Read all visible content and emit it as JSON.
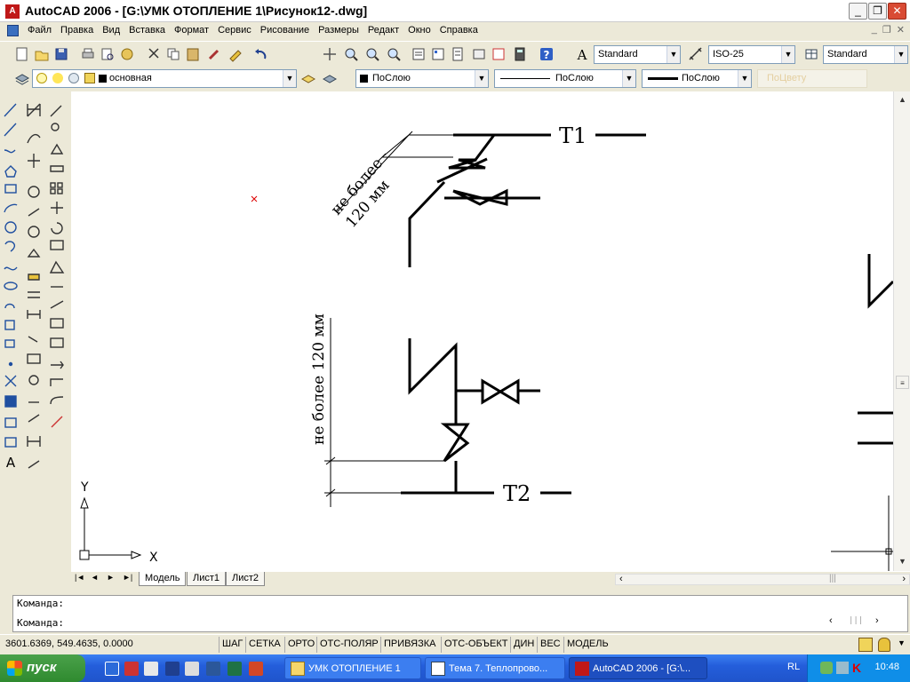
{
  "window": {
    "title": "AutoCAD 2006 - [G:\\УМК ОТОПЛЕНИЕ 1\\Рисунок12-.dwg]",
    "app_icon": "A",
    "minimize": "_",
    "maximize": "❐",
    "close": "✕"
  },
  "menu": {
    "items": [
      "Файл",
      "Правка",
      "Вид",
      "Вставка",
      "Формат",
      "Сервис",
      "Рисование",
      "Размеры",
      "Редакт",
      "Окно",
      "Справка"
    ],
    "mdi": [
      "_",
      "❐",
      "✕"
    ]
  },
  "toolbar": {
    "text_style": "Standard",
    "dim_style": "ISO-25",
    "table_style": "Standard",
    "layer": "основная",
    "color": "ПоСлою",
    "linetype": "ПоСлою",
    "lineweight": "ПоСлою",
    "plotstyle": "ПоЦвету"
  },
  "drawing": {
    "t1_label": "Т1",
    "t2_label": "Т2",
    "dim_text_top_line1": "не более",
    "dim_text_top_line2": "120 мм",
    "dim_text_bottom": "не более 120 мм",
    "ucs_x": "X",
    "ucs_y": "Y"
  },
  "tabs": {
    "items": [
      "Модель",
      "Лист1",
      "Лист2"
    ],
    "active": "Модель",
    "nav": [
      "|◄",
      "◄",
      "►",
      "►|"
    ]
  },
  "command": {
    "line1": "Команда:",
    "line2": "Команда:"
  },
  "status": {
    "coords": "3601.6369, 549.4635, 0.0000",
    "buttons": [
      "ШАГ",
      "СЕТКА",
      "ОРТО",
      "ОТС-ПОЛЯР",
      "ПРИВЯЗКА",
      "ОТС-ОБЪЕКТ",
      "ДИН",
      "ВЕС",
      "МОДЕЛЬ"
    ]
  },
  "taskbar": {
    "start": "пуск",
    "tasks": [
      {
        "label": "УМК ОТОПЛЕНИЕ 1",
        "active": false
      },
      {
        "label": "Тема 7. Теплопрово...",
        "active": false
      },
      {
        "label": "AutoCAD 2006 - [G:\\...",
        "active": true
      }
    ],
    "lang": "RL",
    "clock": "10:48"
  }
}
